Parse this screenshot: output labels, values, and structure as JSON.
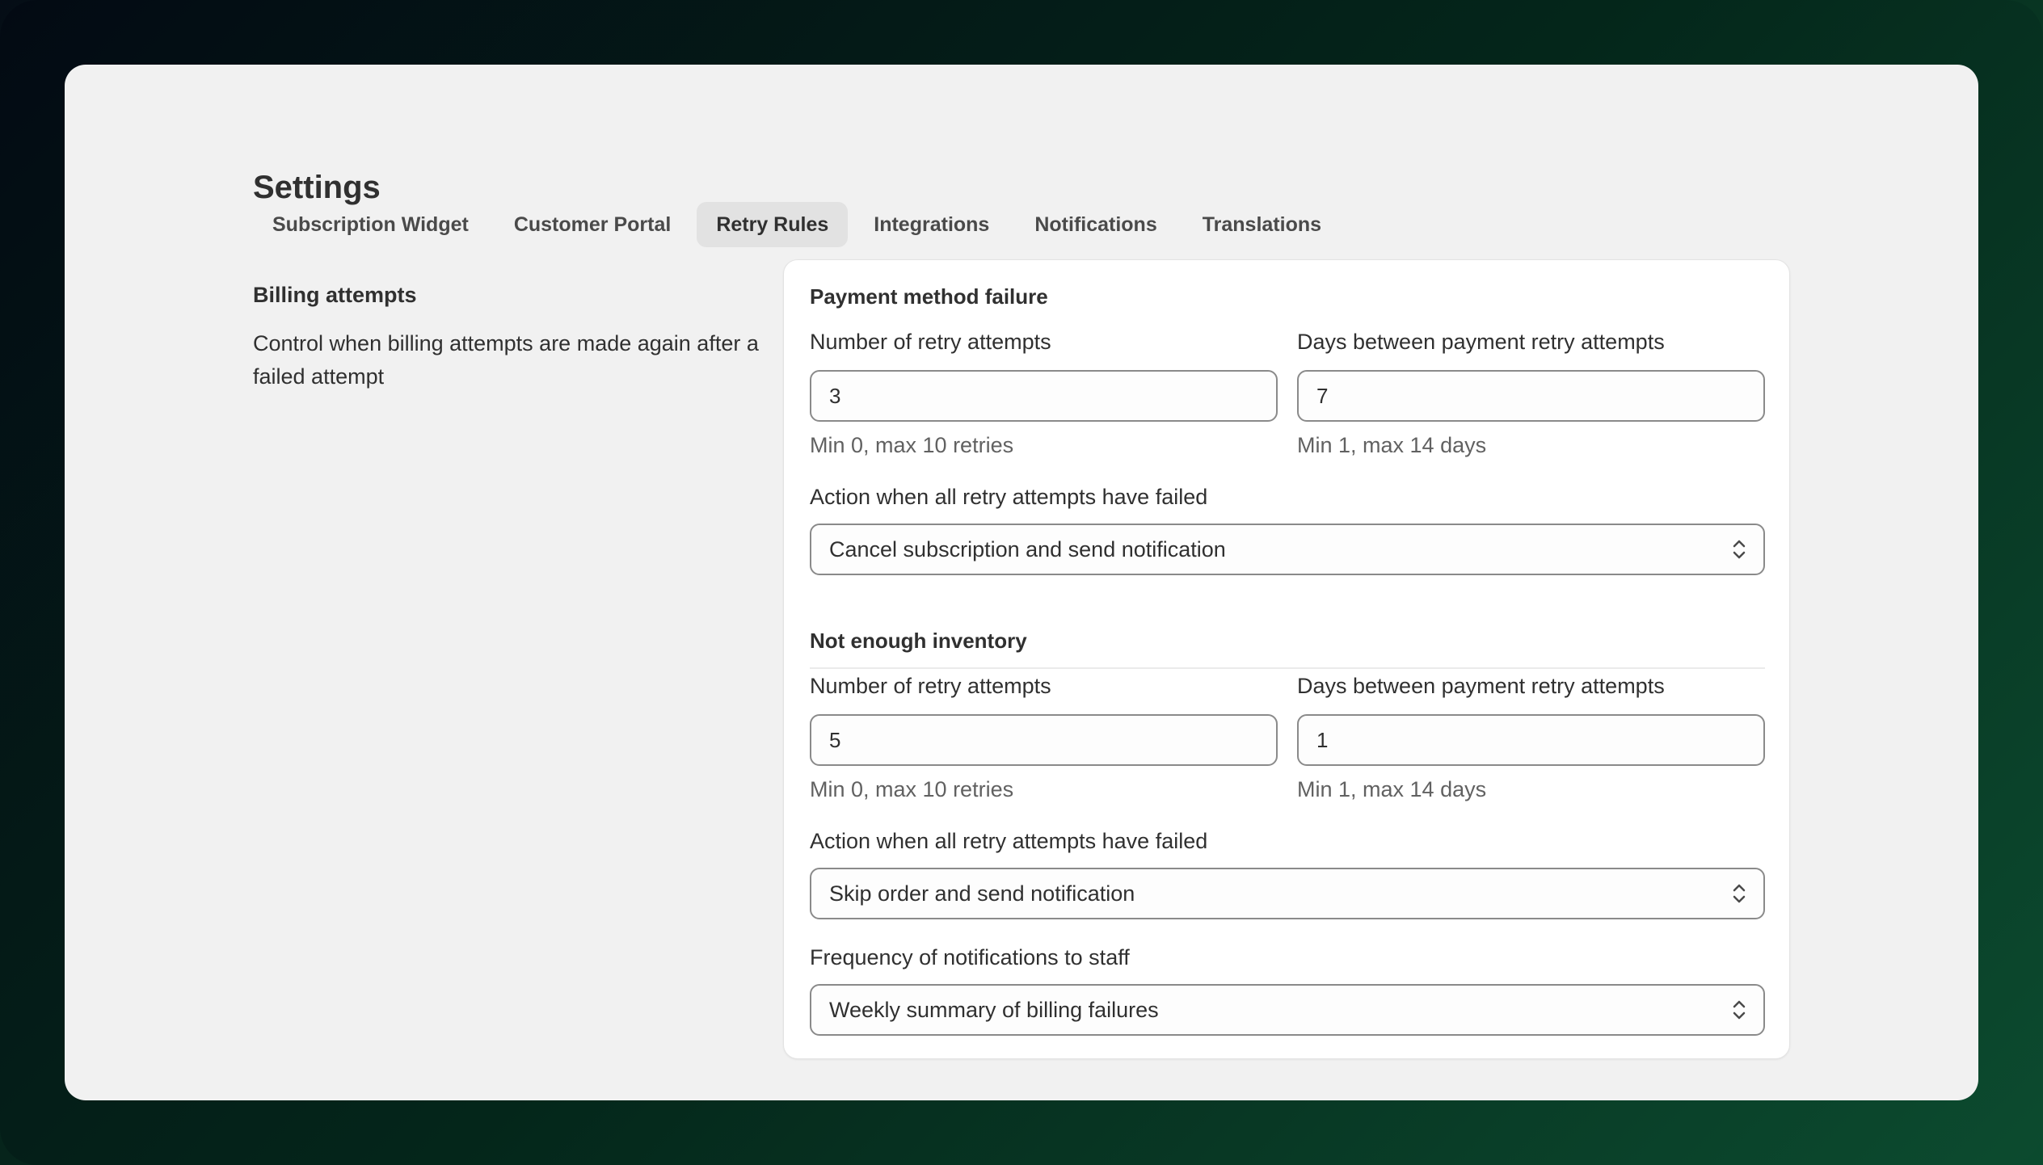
{
  "page": {
    "title": "Settings"
  },
  "tabs": [
    {
      "label": "Subscription Widget",
      "active": false
    },
    {
      "label": "Customer Portal",
      "active": false
    },
    {
      "label": "Retry Rules",
      "active": true
    },
    {
      "label": "Integrations",
      "active": false
    },
    {
      "label": "Notifications",
      "active": false
    },
    {
      "label": "Translations",
      "active": false
    }
  ],
  "billing": {
    "heading": "Billing attempts",
    "description": "Control when billing attempts are made again after a failed attempt"
  },
  "payment_failure": {
    "heading": "Payment method failure",
    "retry_label": "Number of retry attempts",
    "retry_value": "3",
    "retry_help": "Min 0, max 10 retries",
    "days_label": "Days between payment retry attempts",
    "days_value": "7",
    "days_help": "Min 1, max 14 days",
    "action_label": "Action when all retry attempts have failed",
    "action_value": "Cancel subscription and send notification"
  },
  "inventory": {
    "heading": "Not enough inventory",
    "retry_label": "Number of retry attempts",
    "retry_value": "5",
    "retry_help": "Min 0, max 10 retries",
    "days_label": "Days between payment retry attempts",
    "days_value": "1",
    "days_help": "Min 1, max 14 days",
    "action_label": "Action when all retry attempts have failed",
    "action_value": "Skip order and send notification",
    "frequency_label": "Frequency of notifications to staff",
    "frequency_value": "Weekly summary of billing failures"
  },
  "icons": {
    "select_chevron": "chevron-up-down-icon"
  }
}
